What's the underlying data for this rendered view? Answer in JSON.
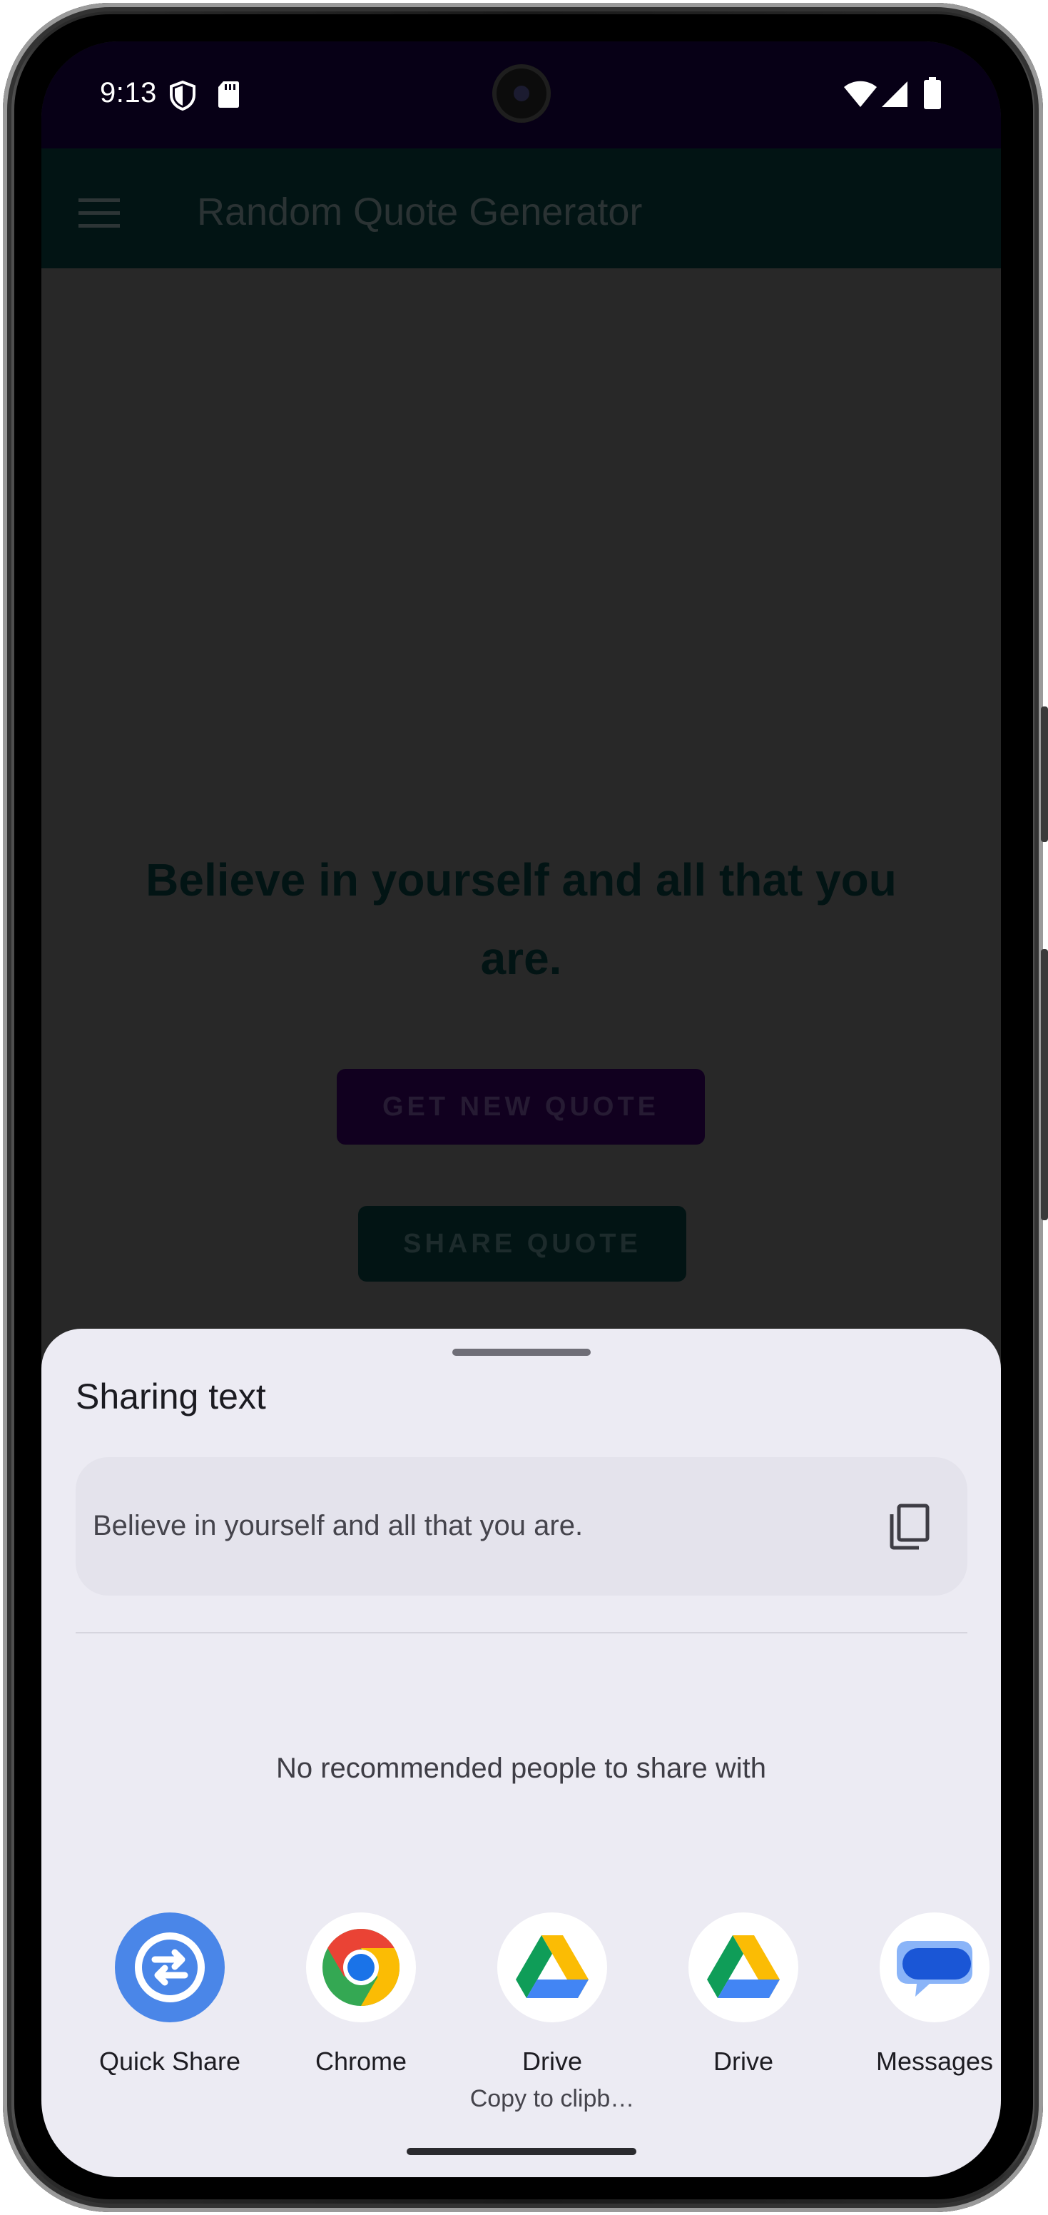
{
  "status_bar": {
    "time": "9:13",
    "icons": [
      "shield-icon",
      "sd-card-icon",
      "wifi-icon",
      "cell-signal-icon",
      "battery-icon"
    ]
  },
  "app": {
    "title": "Random Quote Generator",
    "quote": "Believe in yourself and all that you are.",
    "get_new_quote_label": "GET NEW QUOTE",
    "share_quote_label": "SHARE QUOTE",
    "colors": {
      "scrim": "#282828",
      "app_bar": "#021414",
      "primary_button": "#11001f"
    }
  },
  "share_sheet": {
    "title": "Sharing text",
    "preview_text": "Believe in yourself and all that you are.",
    "copy_icon": "copy-icon",
    "no_people_text": "No recommended people to share with",
    "targets": [
      {
        "label": "Quick Share",
        "sublabel": "",
        "icon": "quick-share-icon"
      },
      {
        "label": "Chrome",
        "sublabel": "",
        "icon": "chrome-icon"
      },
      {
        "label": "Drive",
        "sublabel": "Copy to clipb…",
        "icon": "drive-icon"
      },
      {
        "label": "Drive",
        "sublabel": "",
        "icon": "drive-icon"
      },
      {
        "label": "Messages",
        "sublabel": "",
        "icon": "messages-icon"
      }
    ],
    "colors": {
      "background": "#ecebf3",
      "preview_background": "#e4e3ec"
    }
  }
}
